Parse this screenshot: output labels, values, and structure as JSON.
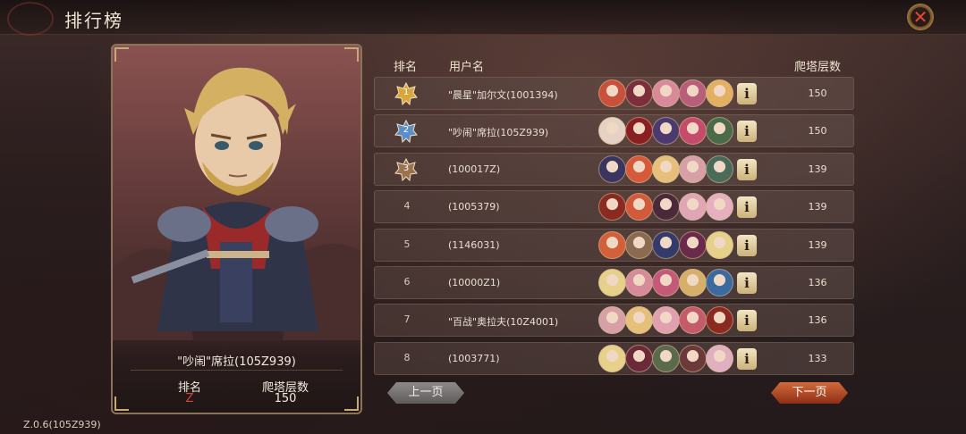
{
  "header": {
    "title": "排行榜"
  },
  "card": {
    "name": "\"吵闹\"席拉(105Z939)",
    "rank_label": "排名",
    "rank_value": "Z",
    "floor_label": "爬塔层数",
    "floor_value": "150"
  },
  "table": {
    "headers": {
      "rank": "排名",
      "user": "用户名",
      "floor": "爬塔层数"
    },
    "rows": [
      {
        "rank": "1",
        "medal": "gold",
        "name": "\"晨星\"加尔文(1001394)",
        "floor": "150",
        "heroes": [
          "#c9503a",
          "#7a2f3a",
          "#d88a9a",
          "#b85d7a",
          "#e2b060"
        ]
      },
      {
        "rank": "2",
        "medal": "silver",
        "name": "\"吵闹\"席拉(105Z939)",
        "floor": "150",
        "heroes": [
          "#e6d2c4",
          "#8a1f22",
          "#4a3a6e",
          "#c44c6a",
          "#4a6a4a"
        ]
      },
      {
        "rank": "3",
        "medal": "bronze",
        "name": "(100017Z)",
        "floor": "139",
        "heroes": [
          "#3a3560",
          "#d65a3a",
          "#e6c07a",
          "#d6a0a6",
          "#4a6a5a"
        ]
      },
      {
        "rank": "4",
        "medal": "",
        "name": "(1005379)",
        "floor": "139",
        "heroes": [
          "#8a2a20",
          "#d05a3a",
          "#4a2a3a",
          "#e0a6b6",
          "#e6b0c0"
        ]
      },
      {
        "rank": "5",
        "medal": "",
        "name": "(1146031)",
        "floor": "139",
        "heroes": [
          "#d2603a",
          "#8a6a50",
          "#343a6a",
          "#6a2a4a",
          "#e6d08a"
        ]
      },
      {
        "rank": "6",
        "medal": "",
        "name": "(10000Z1)",
        "floor": "136",
        "heroes": [
          "#e6d08a",
          "#d68a9a",
          "#c45a7a",
          "#d6b06a",
          "#3a6aa0"
        ]
      },
      {
        "rank": "7",
        "medal": "",
        "name": "\"百战\"奥拉夫(10Z4001)",
        "floor": "136",
        "heroes": [
          "#d6a0a6",
          "#e6c07a",
          "#e0a0b0",
          "#c45a6a",
          "#8a2a20"
        ]
      },
      {
        "rank": "8",
        "medal": "",
        "name": "(1003771)",
        "floor": "133",
        "heroes": [
          "#e6d08a",
          "#6a2a3a",
          "#5a6a4a",
          "#6a3a3a",
          "#e0b0c0"
        ]
      }
    ]
  },
  "buttons": {
    "prev": "上一页",
    "next": "下一页",
    "close_icon": "close-icon",
    "info_icon": "info-icon"
  },
  "footer": {
    "version": "Z.0.6(105Z939)"
  },
  "colors": {
    "gold": "#d9a63a",
    "silver": "#5b8ec7",
    "bronze": "#9a7250",
    "accent_red": "#d8453a"
  }
}
